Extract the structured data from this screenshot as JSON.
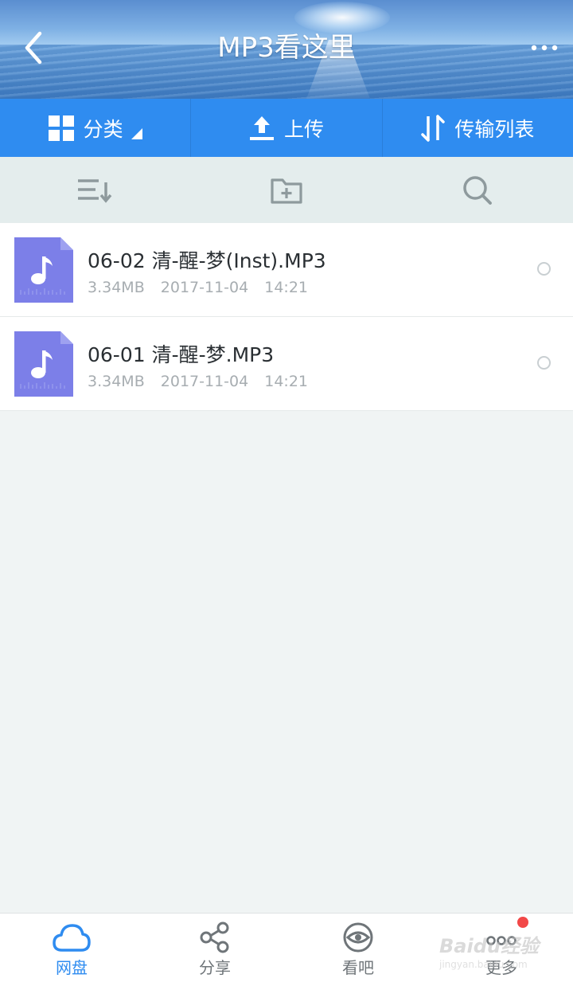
{
  "header": {
    "title": "MP3看这里"
  },
  "toolbar": {
    "category_label": "分类",
    "upload_label": "上传",
    "transfer_label": "传输列表"
  },
  "files": [
    {
      "name": "06-02 清-醒-梦(Inst).MP3",
      "size": "3.34MB",
      "date": "2017-11-04",
      "time": "14:21"
    },
    {
      "name": "06-01 清-醒-梦.MP3",
      "size": "3.34MB",
      "date": "2017-11-04",
      "time": "14:21"
    }
  ],
  "bottom_nav": {
    "items": [
      {
        "label": "网盘",
        "icon": "cloud-icon",
        "active": true
      },
      {
        "label": "分享",
        "icon": "share-icon",
        "active": false
      },
      {
        "label": "看吧",
        "icon": "eye-icon",
        "active": false
      },
      {
        "label": "更多",
        "icon": "more-dots-icon",
        "active": false
      }
    ]
  },
  "watermark": {
    "text": "Baidu经验",
    "sub": "jingyan.baidu.com"
  },
  "colors": {
    "accent": "#2f8cf0",
    "file_icon": "#7c7fe8",
    "badge": "#f24848"
  }
}
